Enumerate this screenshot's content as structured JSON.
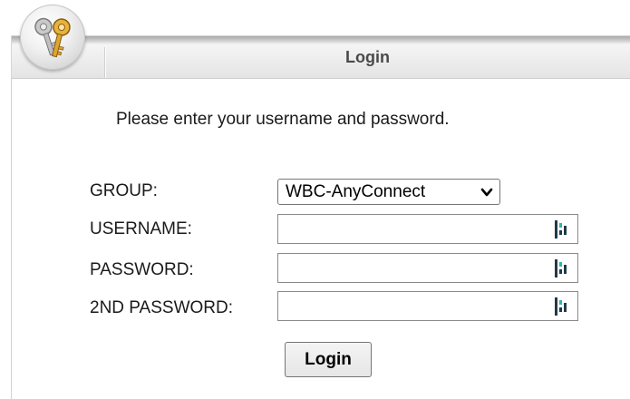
{
  "header": {
    "title": "Login",
    "icon": "keys-icon"
  },
  "form": {
    "instruction": "Please enter your username and password.",
    "group_label": "GROUP:",
    "group_value": "WBC-AnyConnect",
    "username_label": "USERNAME:",
    "username_value": "",
    "password_label": "PASSWORD:",
    "password_value": "",
    "second_password_label": "2ND PASSWORD:",
    "second_password_value": "",
    "field_icon": "password-manager-icon",
    "submit_label": "Login"
  },
  "colors": {
    "field_icon_dark": "#1f3a4a",
    "field_icon_accent": "#2fb7a6"
  }
}
